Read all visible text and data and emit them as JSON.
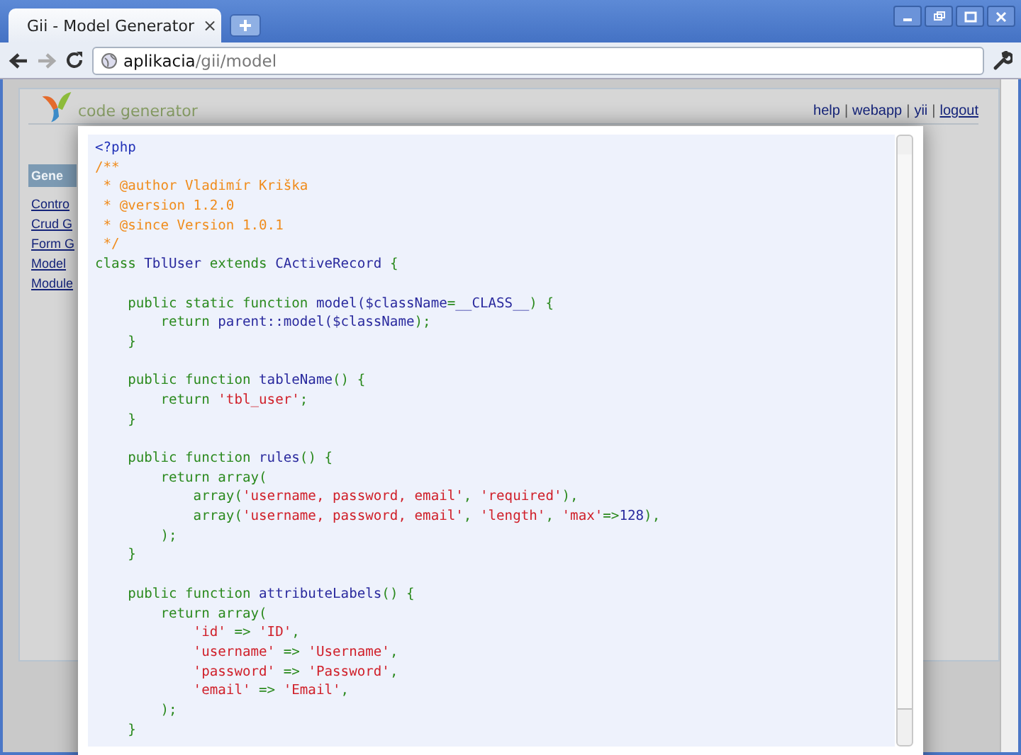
{
  "browser": {
    "tab_title": "Gii - Model Generator",
    "tab_close": "×",
    "url_host": "aplikacia",
    "url_path": "/gii/model"
  },
  "header": {
    "logo_text": "code generator",
    "links": [
      {
        "kind": "link",
        "text": "help",
        "underlined": false
      },
      {
        "kind": "separator",
        "text": "|"
      },
      {
        "kind": "link",
        "text": "webapp",
        "underlined": false
      },
      {
        "kind": "separator",
        "text": "|"
      },
      {
        "kind": "link",
        "text": "yii",
        "underlined": false
      },
      {
        "kind": "separator",
        "text": "|"
      },
      {
        "kind": "link",
        "text": "logout",
        "underlined": true
      }
    ]
  },
  "sidebar": {
    "heading": "Gene",
    "items": [
      "Contro",
      "Crud G",
      "Form G",
      "Model",
      "Module"
    ]
  },
  "code": {
    "blocks": [
      {
        "lines": [
          {
            "tokens": [
              {
                "kind": "tag",
                "text": "<?php"
              }
            ]
          },
          {
            "tokens": [
              {
                "kind": "comment",
                "text": "/**"
              }
            ]
          },
          {
            "tokens": [
              {
                "kind": "comment",
                "text": " * @author Vladimír Kriška"
              }
            ]
          },
          {
            "tokens": [
              {
                "kind": "comment",
                "text": " * @version 1.2.0"
              }
            ]
          },
          {
            "tokens": [
              {
                "kind": "comment",
                "text": " * @since Version 1.0.1"
              }
            ]
          },
          {
            "tokens": [
              {
                "kind": "comment",
                "text": " */"
              }
            ]
          },
          {
            "tokens": [
              {
                "kind": "keyword",
                "text": "class "
              },
              {
                "kind": "name",
                "text": "TblUser"
              },
              {
                "kind": "keyword",
                "text": " extends "
              },
              {
                "kind": "name",
                "text": "CActiveRecord"
              },
              {
                "kind": "keyword",
                "text": " {"
              }
            ]
          }
        ]
      },
      {
        "lines": [
          {
            "tokens": [
              {
                "kind": "keyword",
                "text": "    public static function "
              },
              {
                "kind": "name",
                "text": "model($className"
              },
              {
                "kind": "keyword",
                "text": "="
              },
              {
                "kind": "name",
                "text": "__CLASS__"
              },
              {
                "kind": "keyword",
                "text": ") {"
              }
            ]
          },
          {
            "tokens": [
              {
                "kind": "keyword",
                "text": "        return "
              },
              {
                "kind": "name",
                "text": "parent::model($className"
              },
              {
                "kind": "keyword",
                "text": ");"
              }
            ]
          },
          {
            "tokens": [
              {
                "kind": "keyword",
                "text": "    }"
              }
            ]
          }
        ]
      },
      {
        "lines": [
          {
            "tokens": [
              {
                "kind": "keyword",
                "text": "    public function "
              },
              {
                "kind": "name",
                "text": "tableName"
              },
              {
                "kind": "keyword",
                "text": "() {"
              }
            ]
          },
          {
            "tokens": [
              {
                "kind": "keyword",
                "text": "        return "
              },
              {
                "kind": "string",
                "text": "'tbl_user'"
              },
              {
                "kind": "keyword",
                "text": ";"
              }
            ]
          },
          {
            "tokens": [
              {
                "kind": "keyword",
                "text": "    }"
              }
            ]
          }
        ]
      },
      {
        "lines": [
          {
            "tokens": [
              {
                "kind": "keyword",
                "text": "    public function "
              },
              {
                "kind": "name",
                "text": "rules"
              },
              {
                "kind": "keyword",
                "text": "() {"
              }
            ]
          },
          {
            "tokens": [
              {
                "kind": "keyword",
                "text": "        return array("
              }
            ]
          },
          {
            "tokens": [
              {
                "kind": "keyword",
                "text": "            array("
              },
              {
                "kind": "string",
                "text": "'username, password, email'"
              },
              {
                "kind": "keyword",
                "text": ", "
              },
              {
                "kind": "string",
                "text": "'required'"
              },
              {
                "kind": "keyword",
                "text": "),"
              }
            ]
          },
          {
            "tokens": [
              {
                "kind": "keyword",
                "text": "            array("
              },
              {
                "kind": "string",
                "text": "'username, password, email'"
              },
              {
                "kind": "keyword",
                "text": ", "
              },
              {
                "kind": "string",
                "text": "'length'"
              },
              {
                "kind": "keyword",
                "text": ", "
              },
              {
                "kind": "string",
                "text": "'max'"
              },
              {
                "kind": "keyword",
                "text": "=>"
              },
              {
                "kind": "name",
                "text": "128"
              },
              {
                "kind": "keyword",
                "text": "),"
              }
            ]
          },
          {
            "tokens": [
              {
                "kind": "keyword",
                "text": "        );"
              }
            ]
          },
          {
            "tokens": [
              {
                "kind": "keyword",
                "text": "    }"
              }
            ]
          }
        ]
      },
      {
        "lines": [
          {
            "tokens": [
              {
                "kind": "keyword",
                "text": "    public function "
              },
              {
                "kind": "name",
                "text": "attributeLabels"
              },
              {
                "kind": "keyword",
                "text": "() {"
              }
            ]
          },
          {
            "tokens": [
              {
                "kind": "keyword",
                "text": "        return array("
              }
            ]
          },
          {
            "tokens": [
              {
                "kind": "string",
                "text": "            'id'"
              },
              {
                "kind": "keyword",
                "text": " => "
              },
              {
                "kind": "string",
                "text": "'ID'"
              },
              {
                "kind": "keyword",
                "text": ","
              }
            ]
          },
          {
            "tokens": [
              {
                "kind": "string",
                "text": "            'username'"
              },
              {
                "kind": "keyword",
                "text": " => "
              },
              {
                "kind": "string",
                "text": "'Username'"
              },
              {
                "kind": "keyword",
                "text": ","
              }
            ]
          },
          {
            "tokens": [
              {
                "kind": "string",
                "text": "            'password'"
              },
              {
                "kind": "keyword",
                "text": " => "
              },
              {
                "kind": "string",
                "text": "'Password'"
              },
              {
                "kind": "keyword",
                "text": ","
              }
            ]
          },
          {
            "tokens": [
              {
                "kind": "string",
                "text": "            'email'"
              },
              {
                "kind": "keyword",
                "text": " => "
              },
              {
                "kind": "string",
                "text": "'Email'"
              },
              {
                "kind": "keyword",
                "text": ","
              }
            ]
          },
          {
            "tokens": [
              {
                "kind": "keyword",
                "text": "        );"
              }
            ]
          },
          {
            "tokens": [
              {
                "kind": "keyword",
                "text": "    }"
              }
            ]
          }
        ]
      }
    ]
  }
}
